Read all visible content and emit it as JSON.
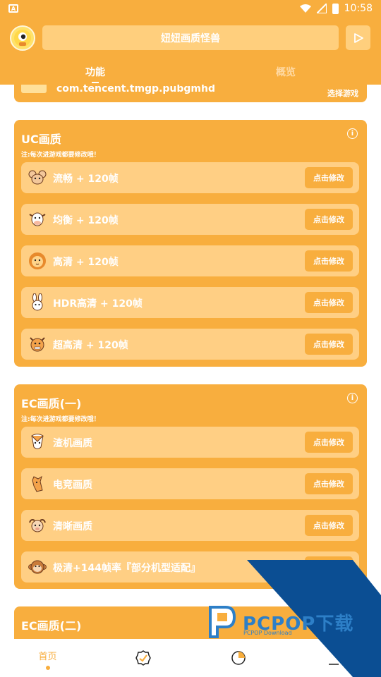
{
  "status_bar": {
    "time": "10:58"
  },
  "header": {
    "search_text": "妞妞画质怪兽",
    "tabs": [
      {
        "label": "功能",
        "active": true
      },
      {
        "label": "概览",
        "active": false
      }
    ]
  },
  "top_card": {
    "package": "com.tencent.tmgp.pubgmhd",
    "select_label": "选择游戏"
  },
  "sections": [
    {
      "title": "UC画质",
      "note": "注:每次进游戏都要修改哦！",
      "rows": [
        {
          "label": "流畅 + 120帧",
          "icon": "mouse-icon",
          "button": "点击修改"
        },
        {
          "label": "均衡 + 120帧",
          "icon": "cow-icon",
          "button": "点击修改"
        },
        {
          "label": "高清 + 120帧",
          "icon": "lion-icon",
          "button": "点击修改"
        },
        {
          "label": "HDR高清 + 120帧",
          "icon": "rabbit-icon",
          "button": "点击修改"
        },
        {
          "label": "超高清 + 120帧",
          "icon": "dragon-icon",
          "button": "点击修改"
        }
      ]
    },
    {
      "title": "EC画质(一)",
      "note": "注:每次进游戏都要修改哦！",
      "rows": [
        {
          "label": "渣机画质",
          "icon": "snake-icon",
          "button": "点击修改"
        },
        {
          "label": "电竞画质",
          "icon": "horse-icon",
          "button": "点击修改"
        },
        {
          "label": "清晰画质",
          "icon": "goat-icon",
          "button": "点击修改"
        },
        {
          "label": "极清+144帧率『部分机型适配』",
          "icon": "monkey-icon",
          "button": "点击修改"
        }
      ]
    },
    {
      "title": "EC画质(二)",
      "note": "",
      "rows": []
    }
  ],
  "bottom_nav": [
    {
      "label": "首页",
      "icon": "home",
      "active": true
    },
    {
      "label": "",
      "icon": "badge-check-icon",
      "active": false
    },
    {
      "label": "",
      "icon": "pie-chart-icon",
      "active": false
    },
    {
      "label": "",
      "icon": "more-icon",
      "active": false
    }
  ],
  "watermark": {
    "title": "PCPOP下载",
    "subtitle": "PCPOP Download"
  },
  "colors": {
    "primary": "#f8ae3e",
    "row": "#ffcf84",
    "search": "#ffcf7d",
    "watermark_blue": "#0b4e93"
  }
}
